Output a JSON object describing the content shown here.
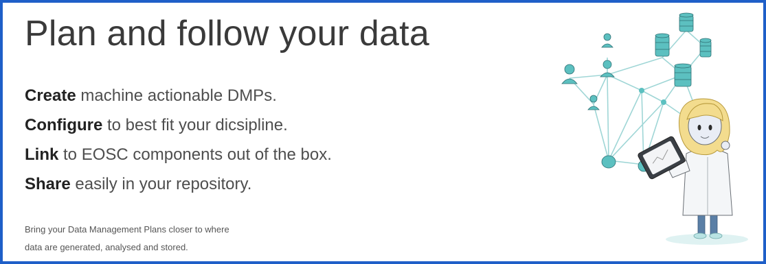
{
  "header": {
    "title": "Plan and follow your data"
  },
  "features": [
    {
      "keyword": "Create",
      "text": " machine actionable DMPs."
    },
    {
      "keyword": "Configure",
      "text": " to best fit your dicsipline."
    },
    {
      "keyword": "Link",
      "text": " to EOSC components out of the box."
    },
    {
      "keyword": "Share",
      "text": " easily in your repository."
    }
  ],
  "blurb": {
    "line1": "Bring your Data Management Plans closer to where",
    "line2": "data are generated, analysed and stored."
  },
  "colors": {
    "frame_border": "#1f5fc8",
    "network_teal": "#5cc0c0",
    "network_line": "#9fd6d6"
  },
  "illustration": {
    "icon": "scientist-with-tablet-and-data-network-illustration"
  }
}
